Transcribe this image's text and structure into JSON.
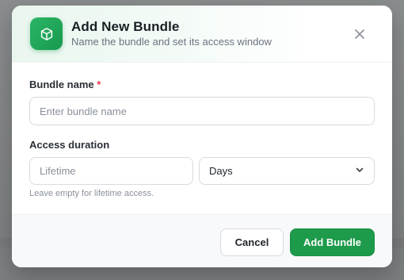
{
  "dialog": {
    "title": "Add New Bundle",
    "subtitle": "Name the bundle and set its access window",
    "icon": "package-icon",
    "close_icon": "close-icon",
    "accent_color": "#1e9a4b"
  },
  "form": {
    "bundle_name": {
      "label": "Bundle name",
      "required_marker": "*",
      "value": "",
      "placeholder": "Enter bundle name"
    },
    "access_duration": {
      "label": "Access duration",
      "value": "",
      "placeholder": "Lifetime",
      "unit_selected": "Days",
      "hint": "Leave empty for lifetime access."
    }
  },
  "footer": {
    "cancel_label": "Cancel",
    "submit_label": "Add Bundle"
  }
}
